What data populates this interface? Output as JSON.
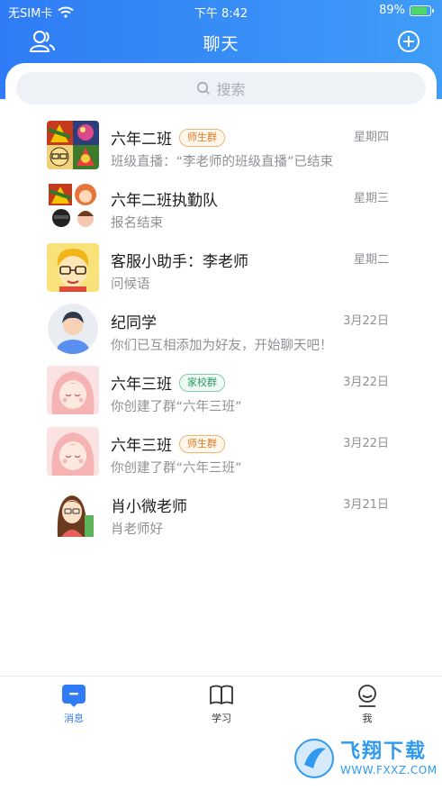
{
  "status_bar": {
    "carrier": "无SIM卡",
    "time": "下午 8:42",
    "battery": "89%",
    "battery_level": 0.89
  },
  "nav": {
    "title": "聊天",
    "left_icon": "contacts-icon",
    "right_icon": "add-circle-icon"
  },
  "search": {
    "placeholder": "搜索"
  },
  "chats": [
    {
      "title": "六年二班",
      "tag": "师生群",
      "tag_color": "orange",
      "subtitle": "班级直播：“李老师的班级直播”已结束",
      "time": "星期四",
      "avatar": "group-avatar"
    },
    {
      "title": "六年二班执勤队",
      "tag": "",
      "subtitle": "报名结束",
      "time": "星期三",
      "avatar": "group-avatar"
    },
    {
      "title": "客服小助手：李老师",
      "tag": "",
      "subtitle": "问候语",
      "time": "星期二",
      "avatar": "cartoon-boy-avatar"
    },
    {
      "title": "纪同学",
      "tag": "",
      "subtitle": "你们已互相添加为好友，开始聊天吧！",
      "time": "3月22日",
      "avatar": "default-user-avatar"
    },
    {
      "title": "六年三班",
      "tag": "家校群",
      "tag_color": "green",
      "subtitle": "你创建了群“六年三班”",
      "time": "3月22日",
      "avatar": "pink-girl-avatar"
    },
    {
      "title": "六年三班",
      "tag": "师生群",
      "tag_color": "orange",
      "subtitle": "你创建了群“六年三班”",
      "time": "3月22日",
      "avatar": "pink-girl-avatar"
    },
    {
      "title": "肖小微老师",
      "tag": "",
      "subtitle": "肖老师好",
      "time": "3月21日",
      "avatar": "teacher-avatar"
    }
  ],
  "tabbar": {
    "items": [
      {
        "label": "消息",
        "icon": "message-icon",
        "active": true
      },
      {
        "label": "学习",
        "icon": "book-icon",
        "active": false
      },
      {
        "label": "我",
        "icon": "profile-icon",
        "active": false
      }
    ]
  },
  "watermark": {
    "big": "飞翔下载",
    "small": "WWW.FXXZ.COM"
  },
  "colors": {
    "accent": "#2f7cf6",
    "tag_orange": "#e07a1f",
    "tag_green": "#2a9b62"
  }
}
